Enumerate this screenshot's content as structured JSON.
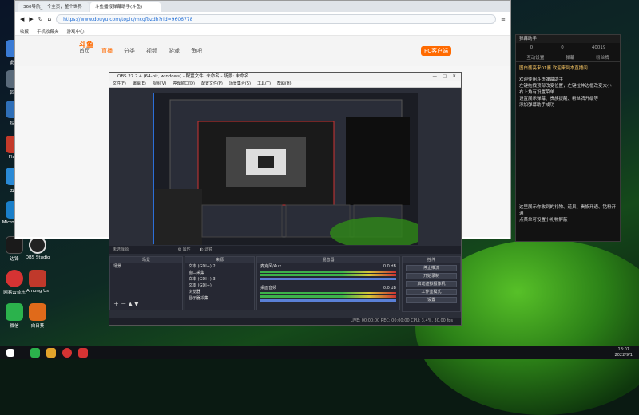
{
  "desktop": {
    "left_icons": [
      {
        "name": "边锋",
        "color": "#1a1a1a"
      },
      {
        "name": "OBS Studio",
        "color": "#1e1e1e"
      },
      {
        "name": "网易云音乐",
        "color": "#d63333"
      },
      {
        "name": "Among Us",
        "color": "#c0392b"
      },
      {
        "name": "微信",
        "color": "#2bb24c"
      },
      {
        "name": "向日葵",
        "color": "#e06a1a"
      }
    ],
    "edge_labels": [
      "此电",
      "回收",
      "控制",
      "Flash",
      "云备",
      "Micro Edge"
    ]
  },
  "browser": {
    "tabs": [
      "360导航_一个主页，整个世界",
      "斗鱼播报弹幕助手(斗鱼)"
    ],
    "url": "https://www.douyu.com/topic/mcgfbzdh?rid=9606778",
    "favorites": [
      "收藏",
      "手机收藏夹",
      "游戏中心"
    ],
    "nav_items": [
      "首页",
      "直播",
      "分类",
      "视频",
      "游戏",
      "鱼吧"
    ],
    "logo": "斗鱼",
    "pcbtn": "PC客户端"
  },
  "side_panel": {
    "title": "弹幕助手",
    "stats": [
      "0",
      "0",
      "40019"
    ],
    "tabs": [
      "互动设置",
      "弹幕",
      "粉丝牌"
    ],
    "banner": "图白酱亮来01酱 欢迎来到本直播间",
    "lines": [
      "欢迎使用斗鱼弹幕助手",
      "左键拖拽顶部改变位置，左键拉伸边框改变大小",
      "右上角有设置菜单",
      "设置展示弹幕、贵族提醒、粉丝牌升级等",
      "添加弹幕助手成功"
    ],
    "bottom_lines": [
      "这里展示你收到的礼物、道具、贵族开通、钻粉开通",
      "点菜单可设置小礼物屏蔽"
    ]
  },
  "obs": {
    "title": "OBS 27.2.4 (64-bit, windows) - 配置文件: 未命名 - 场景: 未命名",
    "menu": [
      "文件(F)",
      "编辑(E)",
      "视图(V)",
      "停靠窗口(D)",
      "配置文件(P)",
      "场景集合(S)",
      "工具(T)",
      "帮助(H)"
    ],
    "source_toolbar": "未选择源",
    "docks": {
      "scenes_title": "场景",
      "scenes": [
        "场景"
      ],
      "sources_title": "来源",
      "sources": [
        "文本 (GDI+) 2",
        "窗口采集",
        "文本 (GDI+) 3",
        "文本 (GDI+)",
        "浏览器",
        "显示器采集"
      ],
      "mixer_title": "混音器",
      "mixer": [
        {
          "name": "麦克风/Aux",
          "db": "0.0 dB"
        },
        {
          "name": "桌面音频",
          "db": "0.0 dB"
        }
      ],
      "controls_title": "控件",
      "controls": [
        "停止推流",
        "开始录制",
        "启动虚拟摄像机",
        "工作室模式",
        "设置",
        "退出"
      ]
    },
    "status": "LIVE: 00:00:00   REC: 00:00:00   CPU: 3.4%, 30.00 fps"
  },
  "taskbar": {
    "time": "18:07",
    "date": "2022/9/1",
    "apps": [
      "#2bb24c",
      "#e3a32b",
      "#d63333",
      "#d63333"
    ]
  }
}
